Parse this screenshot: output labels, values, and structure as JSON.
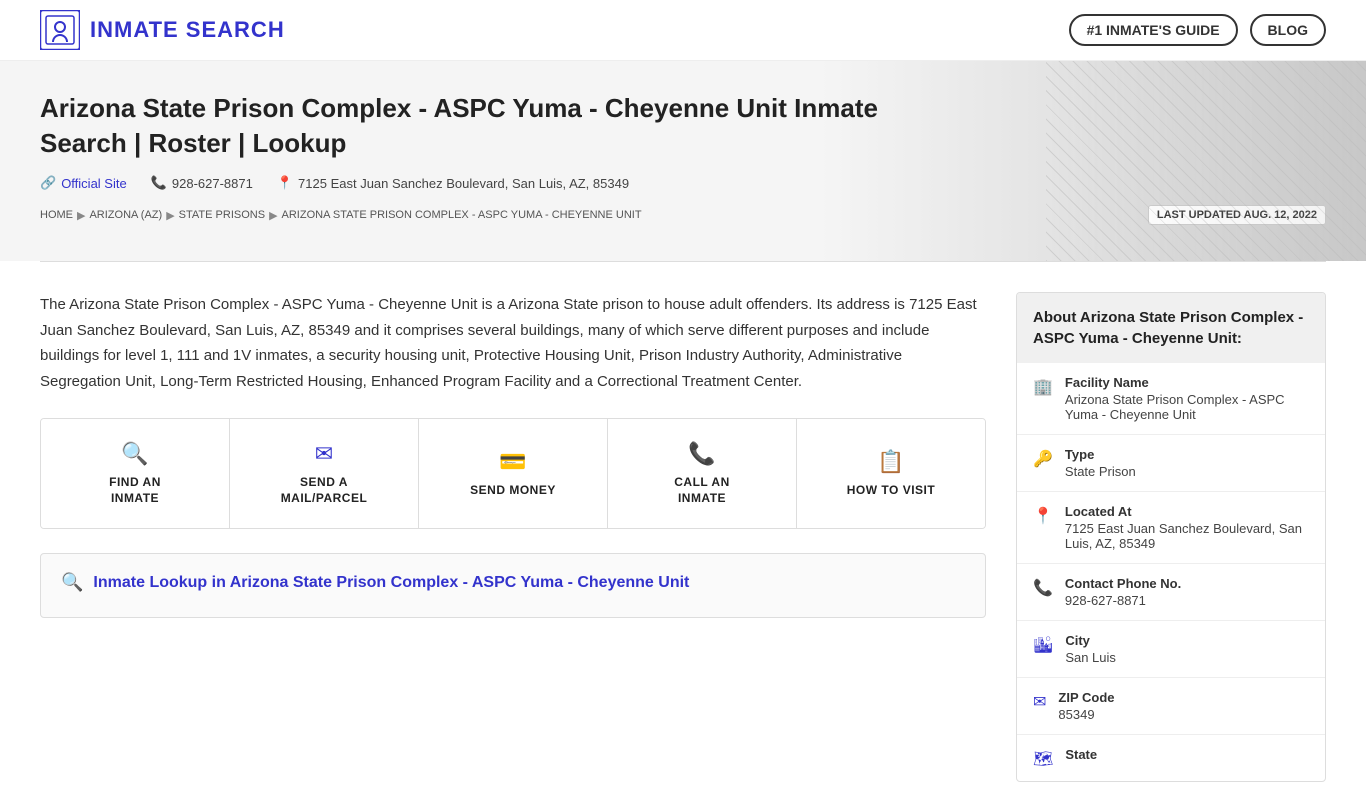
{
  "header": {
    "logo_text": "INMATE SEARCH",
    "nav": {
      "guide_label": "#1 INMATE'S GUIDE",
      "blog_label": "BLOG"
    }
  },
  "hero": {
    "title": "Arizona State Prison Complex - ASPC Yuma - Cheyenne Unit Inmate Search | Roster | Lookup",
    "official_site_label": "Official Site",
    "phone": "928-627-8871",
    "address": "7125 East Juan Sanchez Boulevard, San Luis, AZ, 85349"
  },
  "breadcrumb": {
    "items": [
      {
        "label": "HOME",
        "href": "#"
      },
      {
        "label": "ARIZONA (AZ)",
        "href": "#"
      },
      {
        "label": "STATE PRISONS",
        "href": "#"
      },
      {
        "label": "ARIZONA STATE PRISON COMPLEX - ASPC YUMA - CHEYENNE UNIT",
        "href": "#"
      }
    ],
    "last_updated": "LAST UPDATED AUG. 12, 2022"
  },
  "description": "The Arizona State Prison Complex - ASPC Yuma - Cheyenne Unit is a Arizona State prison to house adult offenders. Its address is 7125 East Juan Sanchez Boulevard, San Luis, AZ, 85349 and it comprises several buildings, many of which serve different purposes and include buildings for level 1, 111 and 1V inmates, a security housing unit, Protective Housing Unit, Prison Industry Authority, Administrative Segregation Unit, Long-Term Restricted Housing, Enhanced Program Facility and a Correctional Treatment Center.",
  "action_cards": [
    {
      "id": "find-inmate",
      "icon": "🔍",
      "label": "FIND AN\nINMATE"
    },
    {
      "id": "send-mail",
      "icon": "✉",
      "label": "SEND A\nMAIL/PARCEL"
    },
    {
      "id": "send-money",
      "icon": "💰",
      "label": "SEND MONEY"
    },
    {
      "id": "call-inmate",
      "icon": "📞",
      "label": "CALL AN\nINMATE"
    },
    {
      "id": "how-to-visit",
      "icon": "📋",
      "label": "HOW TO VISIT"
    }
  ],
  "lookup_section": {
    "title": "Inmate Lookup in Arizona State Prison Complex - ASPC Yuma - Cheyenne Unit"
  },
  "sidebar": {
    "header": "About Arizona State Prison Complex - ASPC Yuma - Cheyenne Unit:",
    "items": [
      {
        "id": "facility-name",
        "icon": "🏢",
        "label": "Facility Name",
        "value": "Arizona State Prison Complex - ASPC Yuma - Cheyenne Unit"
      },
      {
        "id": "type",
        "icon": "🔑",
        "label": "Type",
        "value": "State Prison"
      },
      {
        "id": "located-at",
        "icon": "📍",
        "label": "Located At",
        "value": "7125 East Juan Sanchez Boulevard, San Luis, AZ, 85349"
      },
      {
        "id": "phone",
        "icon": "📞",
        "label": "Contact Phone No.",
        "value": "928-627-8871"
      },
      {
        "id": "city",
        "icon": "🏙",
        "label": "City",
        "value": "San Luis"
      },
      {
        "id": "zip",
        "icon": "✉",
        "label": "ZIP Code",
        "value": "85349"
      },
      {
        "id": "state",
        "icon": "🗺",
        "label": "State",
        "value": ""
      }
    ]
  }
}
